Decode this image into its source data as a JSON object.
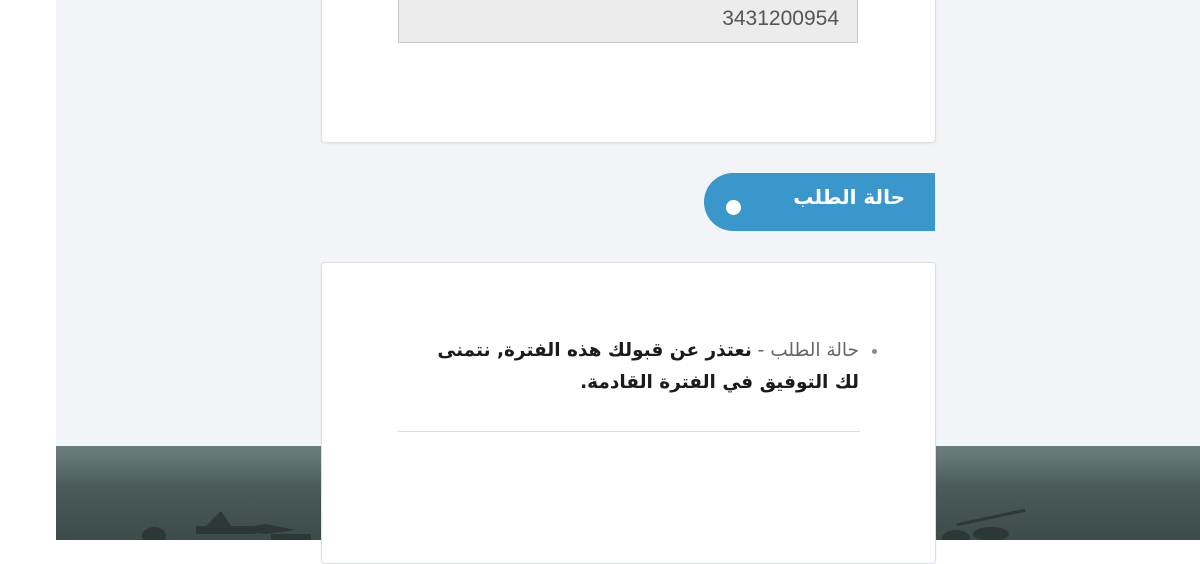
{
  "application": {
    "id_number": "3431200954"
  },
  "status_section": {
    "title": "حالة الطلب"
  },
  "status_details": {
    "label": "حالة الطلب",
    "separator": " - ",
    "message": "نعتذر عن قبولك هذه الفترة, نتمنى لك التوفيق في الفترة القادمة."
  },
  "colors": {
    "accent": "#3a97cb",
    "page_background": "#f2f4f8",
    "field_background": "#ececec"
  },
  "icons": {
    "pill_marker": "dot-icon",
    "list_marker": "bullet-icon"
  }
}
